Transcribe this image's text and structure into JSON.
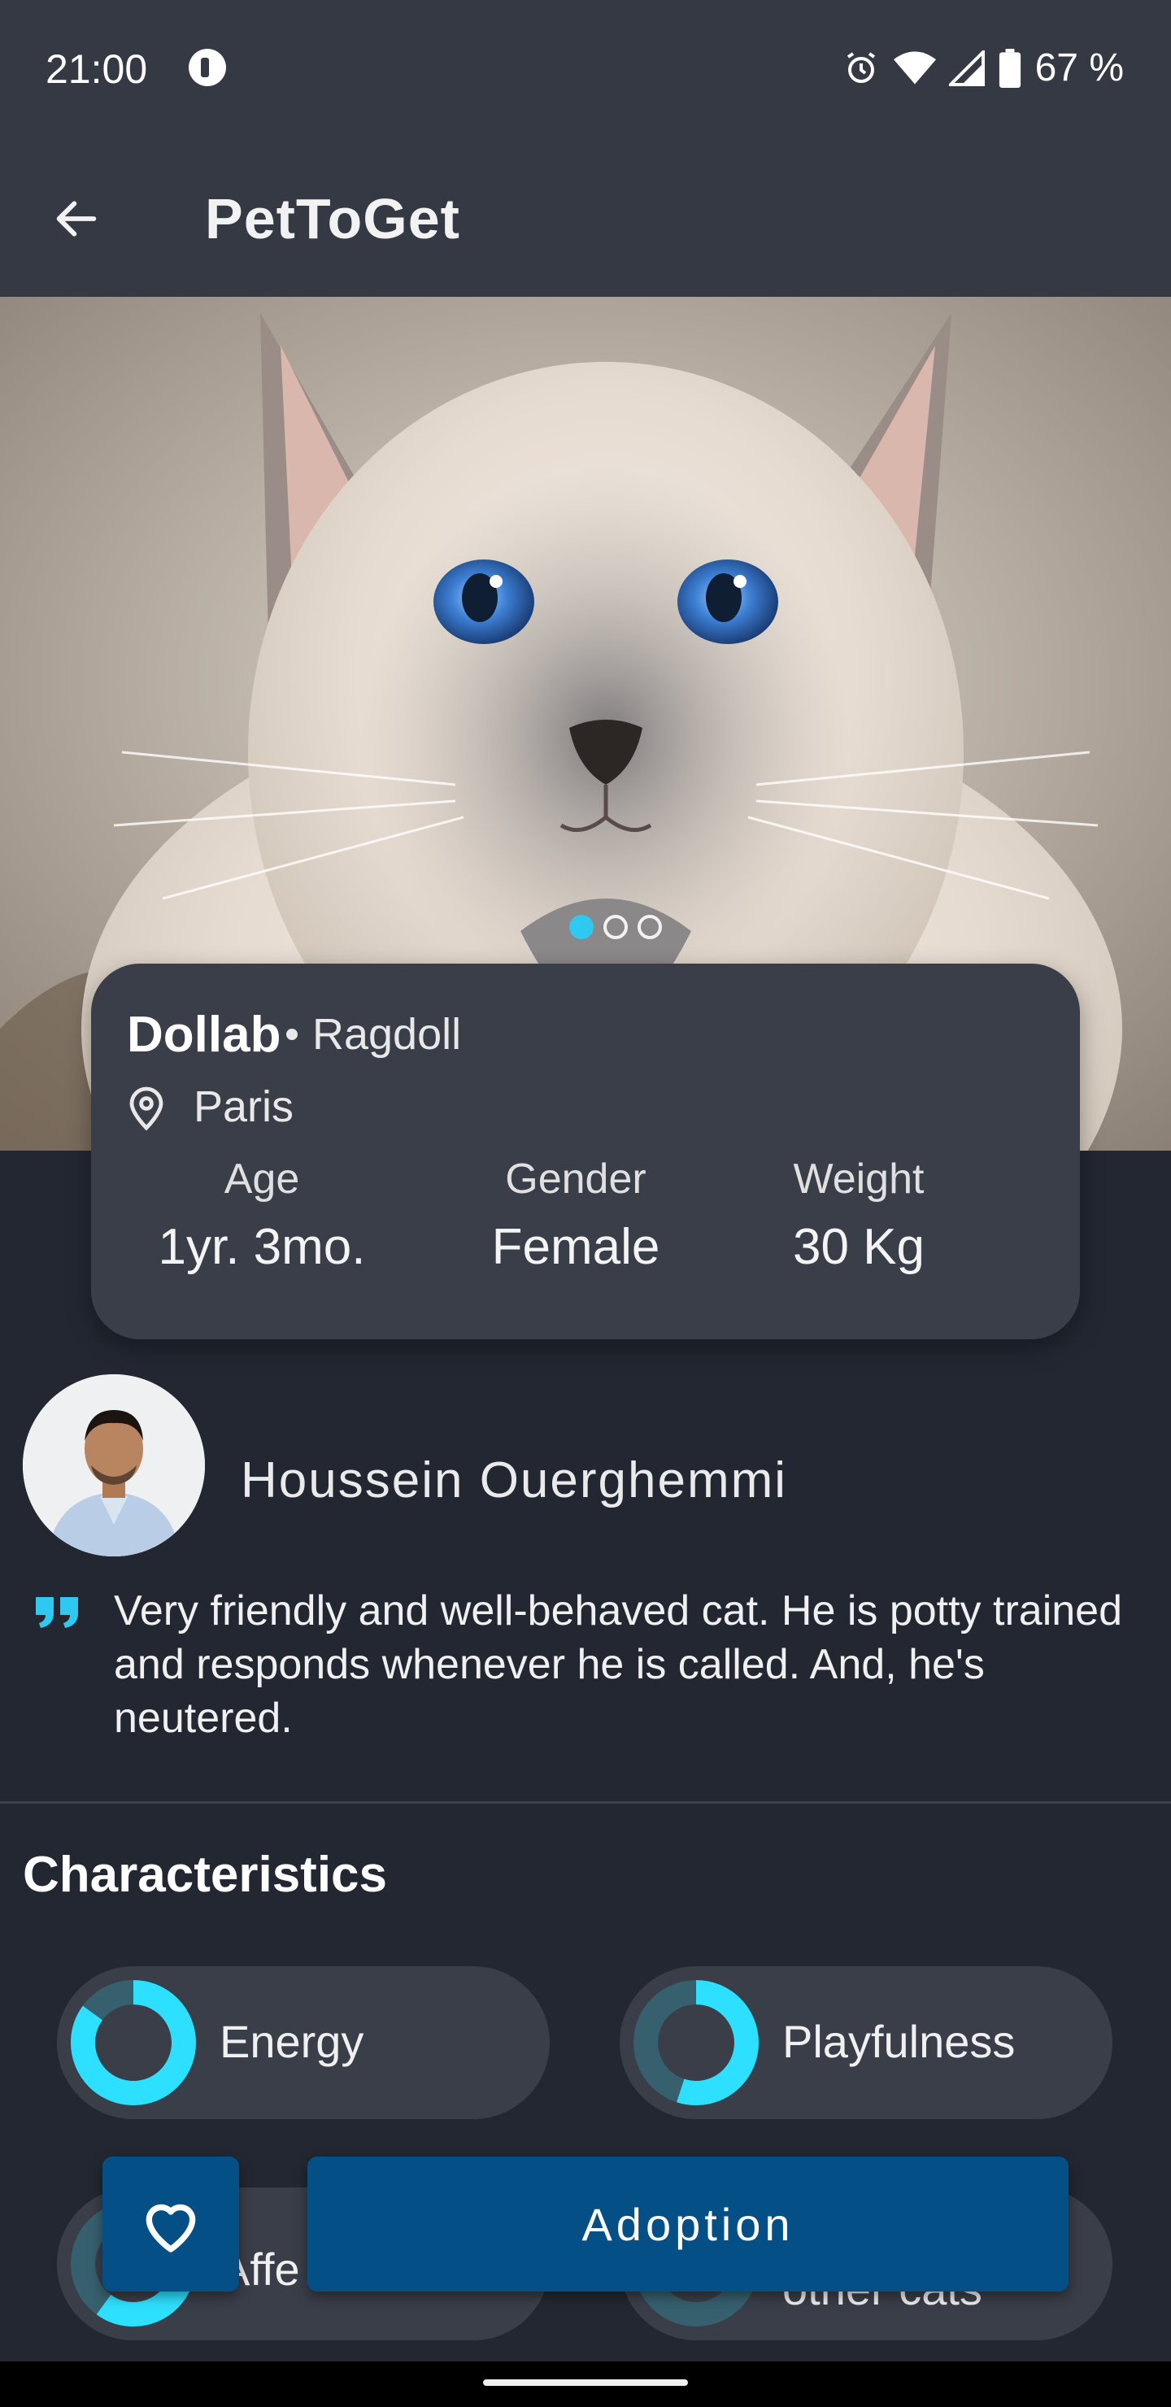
{
  "status_bar": {
    "time": "21:00",
    "battery": "67 %",
    "icons": [
      "pause-circle-icon",
      "alarm-icon",
      "wifi-icon",
      "signal-icon",
      "battery-icon"
    ]
  },
  "app_bar": {
    "title": "PetToGet",
    "back_icon": "arrow-left-icon"
  },
  "gallery": {
    "page_count": 3,
    "active_index": 0
  },
  "pet": {
    "name": "Dollab",
    "breed": "Ragdoll",
    "location": "Paris",
    "stats": [
      {
        "label": "Age",
        "value": "1yr. 3mo."
      },
      {
        "label": "Gender",
        "value": "Female"
      },
      {
        "label": "Weight",
        "value": "30 Kg"
      }
    ]
  },
  "owner": {
    "name": "Houssein Ouerghemmi",
    "description": "Very friendly and well-behaved cat. He is potty trained and responds whenever he is called. And, he's neutered."
  },
  "characteristics": {
    "title": "Characteristics",
    "items": [
      {
        "label": "Energy",
        "level": 0.85
      },
      {
        "label": "Playfulness",
        "level": 0.55
      },
      {
        "label": "Affe",
        "level": 0.6
      },
      {
        "label": "other cats",
        "level": 0.2
      }
    ]
  },
  "actions": {
    "adopt_label": "Adoption",
    "favorite_icon": "heart-icon"
  },
  "colors": {
    "accent": "#2ec8f0",
    "button": "#034f86",
    "background": "#222731",
    "card": "#3a3e48"
  }
}
